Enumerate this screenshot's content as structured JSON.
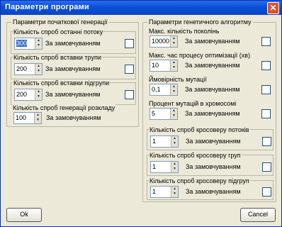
{
  "window": {
    "title": "Параметри програми",
    "close_icon": "close-icon"
  },
  "left": {
    "group_title": "Параметри початкової генерації",
    "fields": [
      {
        "label": "Кількість спроб останні потоку",
        "value": "300",
        "checkbox_label": "За замовчуванням",
        "checked": false
      },
      {
        "label": "Кількість спроб вставки трупи",
        "value": "200",
        "checkbox_label": "За замовчуванням",
        "checked": false
      },
      {
        "label": "Кількість спроб вставки підгрупи",
        "value": "200",
        "checkbox_label": "За замовчуванням",
        "checked": false
      },
      {
        "label": "Кількість спроб генерації розкладу",
        "value": "100",
        "checkbox_label": "За замовчуванням",
        "checked": false
      }
    ]
  },
  "right": {
    "group_title": "Параметри генетичного алгоритму",
    "fields": [
      {
        "label": "Макс. кількість поколінь",
        "value": "10000",
        "checkbox_label": "За замовчуванням",
        "checked": false
      },
      {
        "label": "Макс. час процесу оптимізації (хв)",
        "value": "10",
        "checkbox_label": "За замовчуванням",
        "checked": false
      },
      {
        "label": "Ймовірність мутації",
        "value": "0,1",
        "checkbox_label": "За замовчуванням",
        "checked": false
      },
      {
        "label": "Процент мутацій в хромосомі",
        "value": "5",
        "checkbox_label": "За замовчуванням",
        "checked": false
      },
      {
        "label": "Кількість спроб кросоверу потоків",
        "value": "1",
        "checkbox_label": "За замовчуванням",
        "checked": false
      },
      {
        "label": "Кількість спроб кросоверу груп",
        "value": "1",
        "checkbox_label": "За замовчуванням",
        "checked": false
      },
      {
        "label": "Кількість спроб кросоверу підгруп",
        "value": "1",
        "checkbox_label": "За замовчуванням",
        "checked": false
      }
    ]
  },
  "buttons": {
    "ok": "Ok",
    "cancel": "Cancel"
  }
}
